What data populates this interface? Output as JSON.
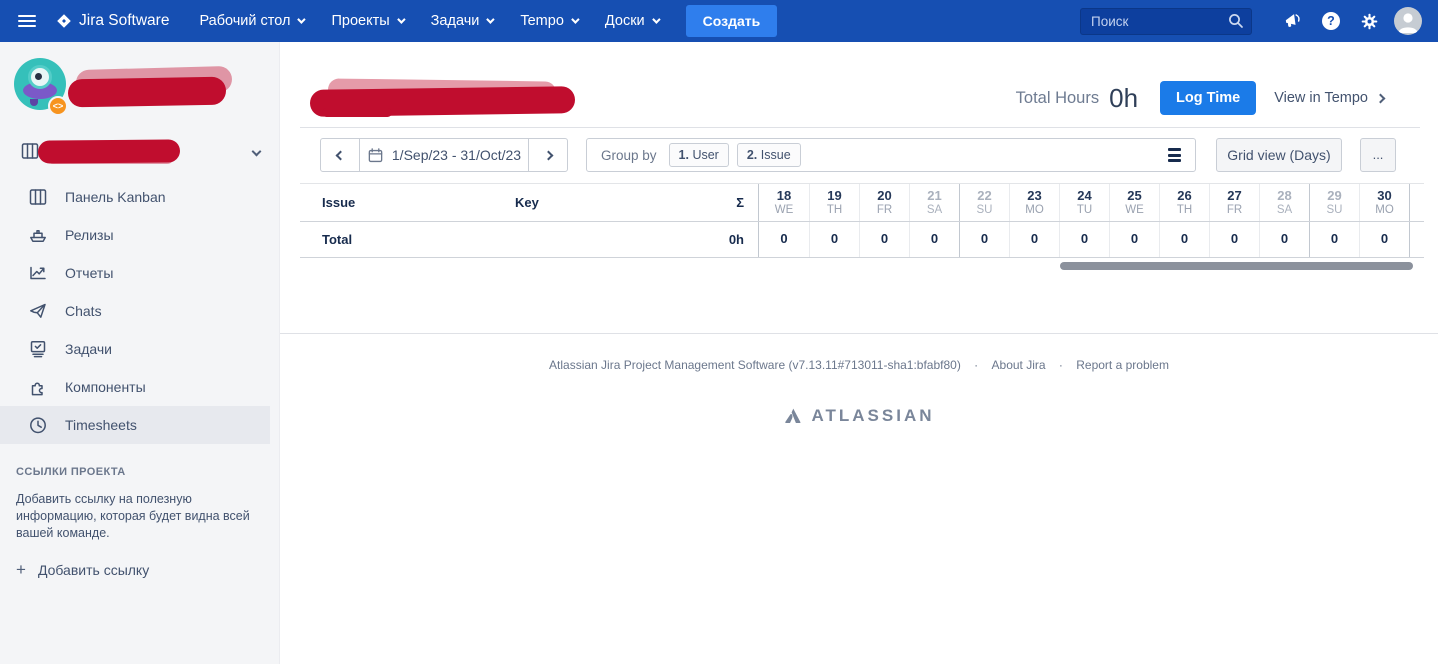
{
  "navbar": {
    "logo": "Jira Software",
    "items": [
      {
        "label": "Рабочий стол"
      },
      {
        "label": "Проекты"
      },
      {
        "label": "Задачи"
      },
      {
        "label": "Tempo"
      },
      {
        "label": "Доски"
      }
    ],
    "create_label": "Создать",
    "search_placeholder": "Поиск",
    "help_glyph": "?",
    "badge_glyph": "<>"
  },
  "sidebar": {
    "items": [
      {
        "label": "Панель Kanban",
        "icon": "kanban-board-icon",
        "selected": false
      },
      {
        "label": "Релизы",
        "icon": "ship-icon",
        "selected": false
      },
      {
        "label": "Отчеты",
        "icon": "chart-icon",
        "selected": false
      },
      {
        "label": "Chats",
        "icon": "paper-plane-icon",
        "selected": false
      },
      {
        "label": "Задачи",
        "icon": "issues-icon",
        "selected": false
      },
      {
        "label": "Компоненты",
        "icon": "component-icon",
        "selected": false
      },
      {
        "label": "Timesheets",
        "icon": "clock-icon",
        "selected": true
      }
    ],
    "links_header": "ССЫЛКИ ПРОЕКТА",
    "links_description": "Добавить ссылку на полезную информацию, которая будет видна всей вашей команде.",
    "add_link_plus": "+",
    "add_link_label": "Добавить ссылку"
  },
  "header": {
    "total_hours_label": "Total Hours",
    "total_hours_value": "0h",
    "log_time_label": "Log Time",
    "view_in_tempo_label": "View in Tempo"
  },
  "toolbar": {
    "date_range": "1/Sep/23 - 31/Oct/23",
    "group_by_label": "Group by",
    "group_chips": [
      {
        "order": "1.",
        "label": "User"
      },
      {
        "order": "2.",
        "label": "Issue"
      }
    ],
    "grid_view_label": "Grid view (Days)",
    "more_label": "..."
  },
  "table": {
    "columns": {
      "issue": "Issue",
      "key": "Key",
      "sum": "Σ"
    },
    "total_label": "Total",
    "total_sum": "0h",
    "days": [
      {
        "num": "18",
        "dow": "WE",
        "weekend": false,
        "week_start": false,
        "value": "0"
      },
      {
        "num": "19",
        "dow": "TH",
        "weekend": false,
        "week_start": false,
        "value": "0"
      },
      {
        "num": "20",
        "dow": "FR",
        "weekend": false,
        "week_start": false,
        "value": "0"
      },
      {
        "num": "21",
        "dow": "SA",
        "weekend": true,
        "week_start": false,
        "value": "0"
      },
      {
        "num": "22",
        "dow": "SU",
        "weekend": true,
        "week_start": true,
        "value": "0"
      },
      {
        "num": "23",
        "dow": "MO",
        "weekend": false,
        "week_start": false,
        "value": "0"
      },
      {
        "num": "24",
        "dow": "TU",
        "weekend": false,
        "week_start": false,
        "value": "0"
      },
      {
        "num": "25",
        "dow": "WE",
        "weekend": false,
        "week_start": false,
        "value": "0"
      },
      {
        "num": "26",
        "dow": "TH",
        "weekend": false,
        "week_start": false,
        "value": "0"
      },
      {
        "num": "27",
        "dow": "FR",
        "weekend": false,
        "week_start": false,
        "value": "0"
      },
      {
        "num": "28",
        "dow": "SA",
        "weekend": true,
        "week_start": false,
        "value": "0"
      },
      {
        "num": "29",
        "dow": "SU",
        "weekend": true,
        "week_start": true,
        "value": "0"
      },
      {
        "num": "30",
        "dow": "MO",
        "weekend": false,
        "week_start": false,
        "value": "0"
      }
    ]
  },
  "footer": {
    "version_text": "Atlassian Jira Project Management Software (v7.13.11#713011-sha1:bfabf80)",
    "dot": "·",
    "about_label": "About Jira",
    "report_label": "Report a problem",
    "brand": "ATLASSIAN"
  },
  "colors": {
    "navbar": "#164fb2",
    "create_button": "#2f7eed",
    "log_time_button": "#1b7be8",
    "redaction": "#c00d2e",
    "sidebar_bg": "#f4f5f7",
    "selected_item_bg": "#e7e9ee"
  }
}
